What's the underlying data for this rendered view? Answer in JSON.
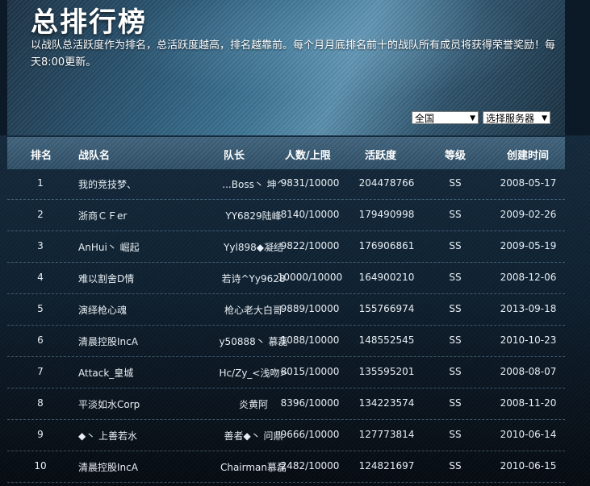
{
  "header": {
    "title": "总排行榜",
    "description": "以战队总活跃度作为排名，总活跃度越高，排名越靠前。每个月月底排名前十的战队所有成员将获得荣誉奖励！每天8:00更新。"
  },
  "filters": {
    "region_selected": "全国",
    "server_selected": "选择服务器"
  },
  "table": {
    "columns": [
      "排名",
      "战队名",
      "队长",
      "人数/上限",
      "活跃度",
      "等级",
      "创建时间"
    ],
    "rows": [
      {
        "rank": "1",
        "name": "我的竞技梦、",
        "leader": "...Boss丶 坤^",
        "members": "9831/10000",
        "activity": "204478766",
        "level": "SS",
        "created": "2008-05-17"
      },
      {
        "rank": "2",
        "name": "浙商ＣＦer",
        "leader": "YY6829陆峰",
        "members": "8140/10000",
        "activity": "179490998",
        "level": "SS",
        "created": "2009-02-26"
      },
      {
        "rank": "3",
        "name": "AnHui丶 崛起",
        "leader": "Yyl898◆凝结",
        "members": "9822/10000",
        "activity": "176906861",
        "level": "SS",
        "created": "2009-05-19"
      },
      {
        "rank": "4",
        "name": "难以割舍D情",
        "leader": "若诗^Yy9628",
        "members": "10000/10000",
        "activity": "164900210",
        "level": "SS",
        "created": "2008-12-06"
      },
      {
        "rank": "5",
        "name": "演绎枪心魂",
        "leader": "枪心老大白哥",
        "members": "9889/10000",
        "activity": "155766974",
        "level": "SS",
        "created": "2013-09-18"
      },
      {
        "rank": "6",
        "name": "清晨控股IncA",
        "leader": "y50888丶 慕磊",
        "members": "1088/10000",
        "activity": "148552545",
        "level": "SS",
        "created": "2010-10-23"
      },
      {
        "rank": "7",
        "name": "Attack_皇城",
        "leader": "Hc/Zy_<浅吻>",
        "members": "8015/10000",
        "activity": "135595201",
        "level": "SS",
        "created": "2008-08-07"
      },
      {
        "rank": "8",
        "name": "平淡如水Corp",
        "leader": "炎黄阿",
        "members": "8396/10000",
        "activity": "134223574",
        "level": "SS",
        "created": "2008-11-20"
      },
      {
        "rank": "9",
        "name": "◆丶 上善若水",
        "leader": "善者◆丶 问鼎",
        "members": "9666/10000",
        "activity": "127773814",
        "level": "SS",
        "created": "2010-06-14"
      },
      {
        "rank": "10",
        "name": "清晨控股IncA",
        "leader": "Chairman慕磊",
        "members": "2482/10000",
        "activity": "124821697",
        "level": "SS",
        "created": "2010-06-15"
      }
    ]
  }
}
